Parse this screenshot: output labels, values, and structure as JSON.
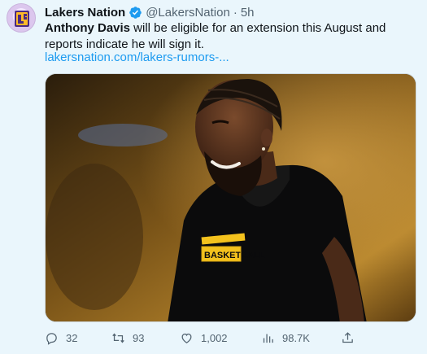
{
  "tweet": {
    "author_name": "Lakers Nation",
    "handle": "@LakersNation",
    "separator": "·",
    "time": "5h",
    "text_bold": "Anthony Davis",
    "text_rest": " will be eligible for an extension this August and reports indicate he will sign it.",
    "link": "lakersnation.com/lakers-rumors-..."
  },
  "actions": {
    "replies": "32",
    "retweets": "93",
    "likes": "1,002",
    "views": "98.7K"
  },
  "colors": {
    "background": "#eaf6fc",
    "link": "#1d9bf0",
    "verified": "#1d9bf0",
    "secondary_text": "#536471",
    "jersey_gold": "#f4c21d"
  },
  "icons": [
    "verified-badge-icon",
    "reply-icon",
    "retweet-icon",
    "like-icon",
    "views-icon",
    "share-icon"
  ]
}
